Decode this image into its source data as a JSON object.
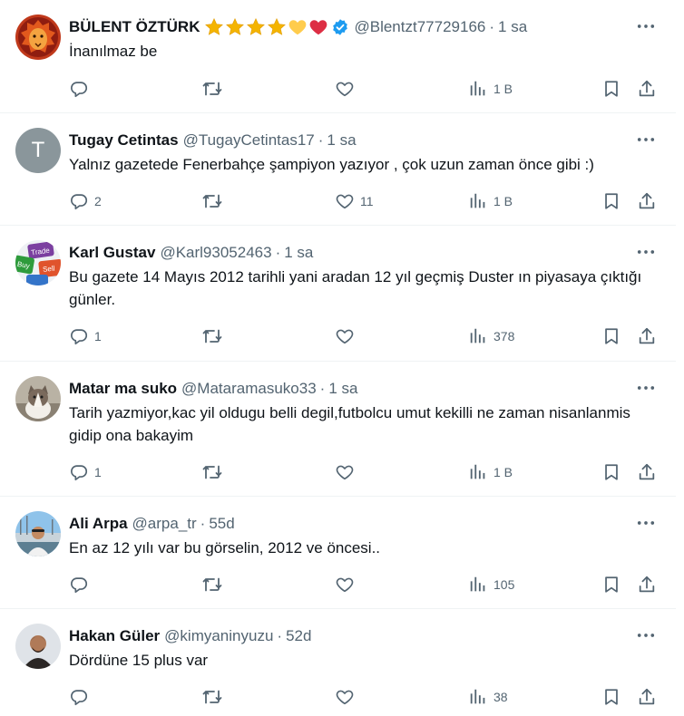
{
  "tweets": [
    {
      "name": "BÜLENT ÖZTÜRK",
      "handle": "@Blentzt77729166",
      "sep": "·",
      "time": "1 sa",
      "text": "İnanılmaz be",
      "replies": "",
      "retweets": "",
      "likes": "",
      "views": "1 B",
      "verified": true,
      "avatar": "lion-avatar"
    },
    {
      "name": "Tugay Cetintas",
      "handle": "@TugayCetintas17",
      "sep": "·",
      "time": "1 sa",
      "text": "Yalnız gazetede Fenerbahçe şampiyon yazıyor , çok uzun zaman önce gibi :)",
      "replies": "2",
      "retweets": "",
      "likes": "11",
      "views": "1 B",
      "avatar_letter": "T"
    },
    {
      "name": "Karl Gustav",
      "handle": "@Karl93052463",
      "sep": "·",
      "time": "1 sa",
      "text": "Bu gazete 14 Mayıs 2012 tarihli yani aradan 12 yıl geçmiş Duster ın piyasaya çıktığı günler.",
      "replies": "1",
      "retweets": "",
      "likes": "",
      "views": "378",
      "avatar": "trade-buy-sell-avatar",
      "avatar_words": [
        "Trade",
        "Buy",
        "Sell"
      ]
    },
    {
      "name": "Matar ma suko",
      "handle": "@Mataramasuko33",
      "sep": "·",
      "time": "1 sa",
      "text": "Tarih yazmiyor,kac yil oldugu belli degil,futbolcu umut kekilli ne zaman nisanlanmis gidip ona bakayim",
      "replies": "1",
      "retweets": "",
      "likes": "",
      "views": "1 B",
      "avatar": "cat-avatar"
    },
    {
      "name": "Ali Arpa",
      "handle": "@arpa_tr",
      "sep": "·",
      "time": "55d",
      "text": "En az 12 yılı var bu görselin, 2012 ve öncesi..",
      "replies": "",
      "retweets": "",
      "likes": "",
      "views": "105",
      "avatar": "person-harbor-avatar"
    },
    {
      "name": "Hakan Güler",
      "handle": "@kimyaninyuzu",
      "sep": "·",
      "time": "52d",
      "text": "Dördüne 15 plus var",
      "replies": "",
      "retweets": "",
      "likes": "",
      "views": "38",
      "avatar": "person-portrait-avatar"
    }
  ],
  "colors": {
    "text": "#0f1419",
    "muted": "#536471",
    "verified": "#1d9bf0",
    "star": "#f4b400",
    "heart": "#dd2e44",
    "yellow_heart": "#ffcc4d",
    "divider": "#eff3f4"
  },
  "icons": [
    "reply-icon",
    "retweet-icon",
    "like-icon",
    "views-icon",
    "bookmark-icon",
    "share-icon",
    "more-icon",
    "verified-icon",
    "star-icon"
  ]
}
